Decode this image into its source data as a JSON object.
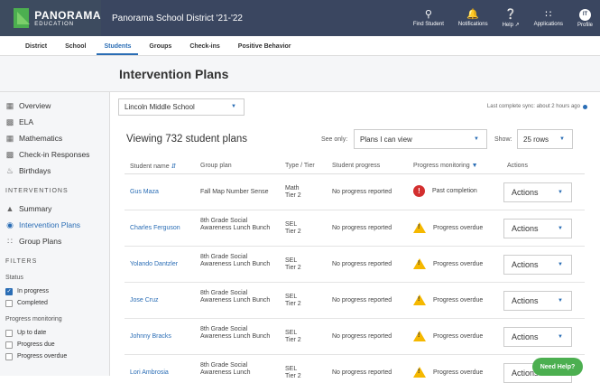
{
  "brand": {
    "title": "PANORAMA",
    "subtitle": "EDUCATION"
  },
  "district": "Panorama School District '21-'22",
  "topnav": [
    {
      "label": "Find Student",
      "icon": "search-icon"
    },
    {
      "label": "Notifications",
      "icon": "bell-icon"
    },
    {
      "label": "Help ↗",
      "icon": "help-icon"
    },
    {
      "label": "Applications",
      "icon": "grid-icon"
    },
    {
      "label": "Profile",
      "icon": "avatar-icon",
      "initials": "IT"
    }
  ],
  "subnav": [
    "District",
    "School",
    "Students",
    "Groups",
    "Check-ins",
    "Positive Behavior"
  ],
  "subnav_active": "Students",
  "page_title": "Intervention Plans",
  "sidebar": {
    "items": [
      {
        "label": "Overview",
        "icon": "overview-icon"
      },
      {
        "label": "ELA",
        "icon": "book-icon"
      },
      {
        "label": "Mathematics",
        "icon": "calculator-icon"
      },
      {
        "label": "Check-in Responses",
        "icon": "checkin-icon"
      },
      {
        "label": "Birthdays",
        "icon": "cake-icon"
      }
    ],
    "interventions_heading": "INTERVENTIONS",
    "interventions": [
      {
        "label": "Summary",
        "icon": "summary-icon"
      },
      {
        "label": "Intervention Plans",
        "icon": "target-icon",
        "active": true
      },
      {
        "label": "Group Plans",
        "icon": "group-icon"
      }
    ],
    "filters_heading": "FILTERS",
    "status_label": "Status",
    "status_filters": [
      {
        "label": "In progress",
        "checked": true
      },
      {
        "label": "Completed",
        "checked": false
      }
    ],
    "progress_label": "Progress monitoring",
    "progress_filters": [
      {
        "label": "Up to date",
        "checked": false
      },
      {
        "label": "Progress due",
        "checked": false
      },
      {
        "label": "Progress overdue",
        "checked": false
      }
    ]
  },
  "school_select": "Lincoln Middle School",
  "sync_text": "Last complete sync: about 2 hours ago",
  "viewing": "Viewing 732 student plans",
  "see_only_label": "See only:",
  "see_only_value": "Plans I can view",
  "show_label": "Show:",
  "rows_value": "25 rows",
  "table": {
    "headers": [
      "Student name",
      "Group plan",
      "Type / Tier",
      "Student progress",
      "Progress monitoring",
      "Actions"
    ],
    "rows": [
      {
        "name": "Gus Maza",
        "plan": "Fall Map Number Sense",
        "type": "Math",
        "tier": "Tier 2",
        "progress": "No progress reported",
        "monitoring": "Past completion",
        "status": "error",
        "action": "Actions"
      },
      {
        "name": "Charles Ferguson",
        "plan": "8th Grade Social Awareness Lunch Bunch",
        "type": "SEL",
        "tier": "Tier 2",
        "progress": "No progress reported",
        "monitoring": "Progress overdue",
        "status": "warning",
        "action": "Actions"
      },
      {
        "name": "Yolando Dantzler",
        "plan": "8th Grade Social Awareness Lunch Bunch",
        "type": "SEL",
        "tier": "Tier 2",
        "progress": "No progress reported",
        "monitoring": "Progress overdue",
        "status": "warning",
        "action": "Actions"
      },
      {
        "name": "Jose Cruz",
        "plan": "8th Grade Social Awareness Lunch Bunch",
        "type": "SEL",
        "tier": "Tier 2",
        "progress": "No progress reported",
        "monitoring": "Progress overdue",
        "status": "warning",
        "action": "Actions"
      },
      {
        "name": "Johnny Bracks",
        "plan": "8th Grade Social Awareness Lunch Bunch",
        "type": "SEL",
        "tier": "Tier 2",
        "progress": "No progress reported",
        "monitoring": "Progress overdue",
        "status": "warning",
        "action": "Actions"
      },
      {
        "name": "Lori Ambrosia",
        "plan": "8th Grade Social Awareness Lunch",
        "type": "SEL",
        "tier": "Tier 2",
        "progress": "No progress reported",
        "monitoring": "Progress overdue",
        "status": "warning",
        "action": "Actions"
      }
    ]
  },
  "help_button": "Need Help?"
}
